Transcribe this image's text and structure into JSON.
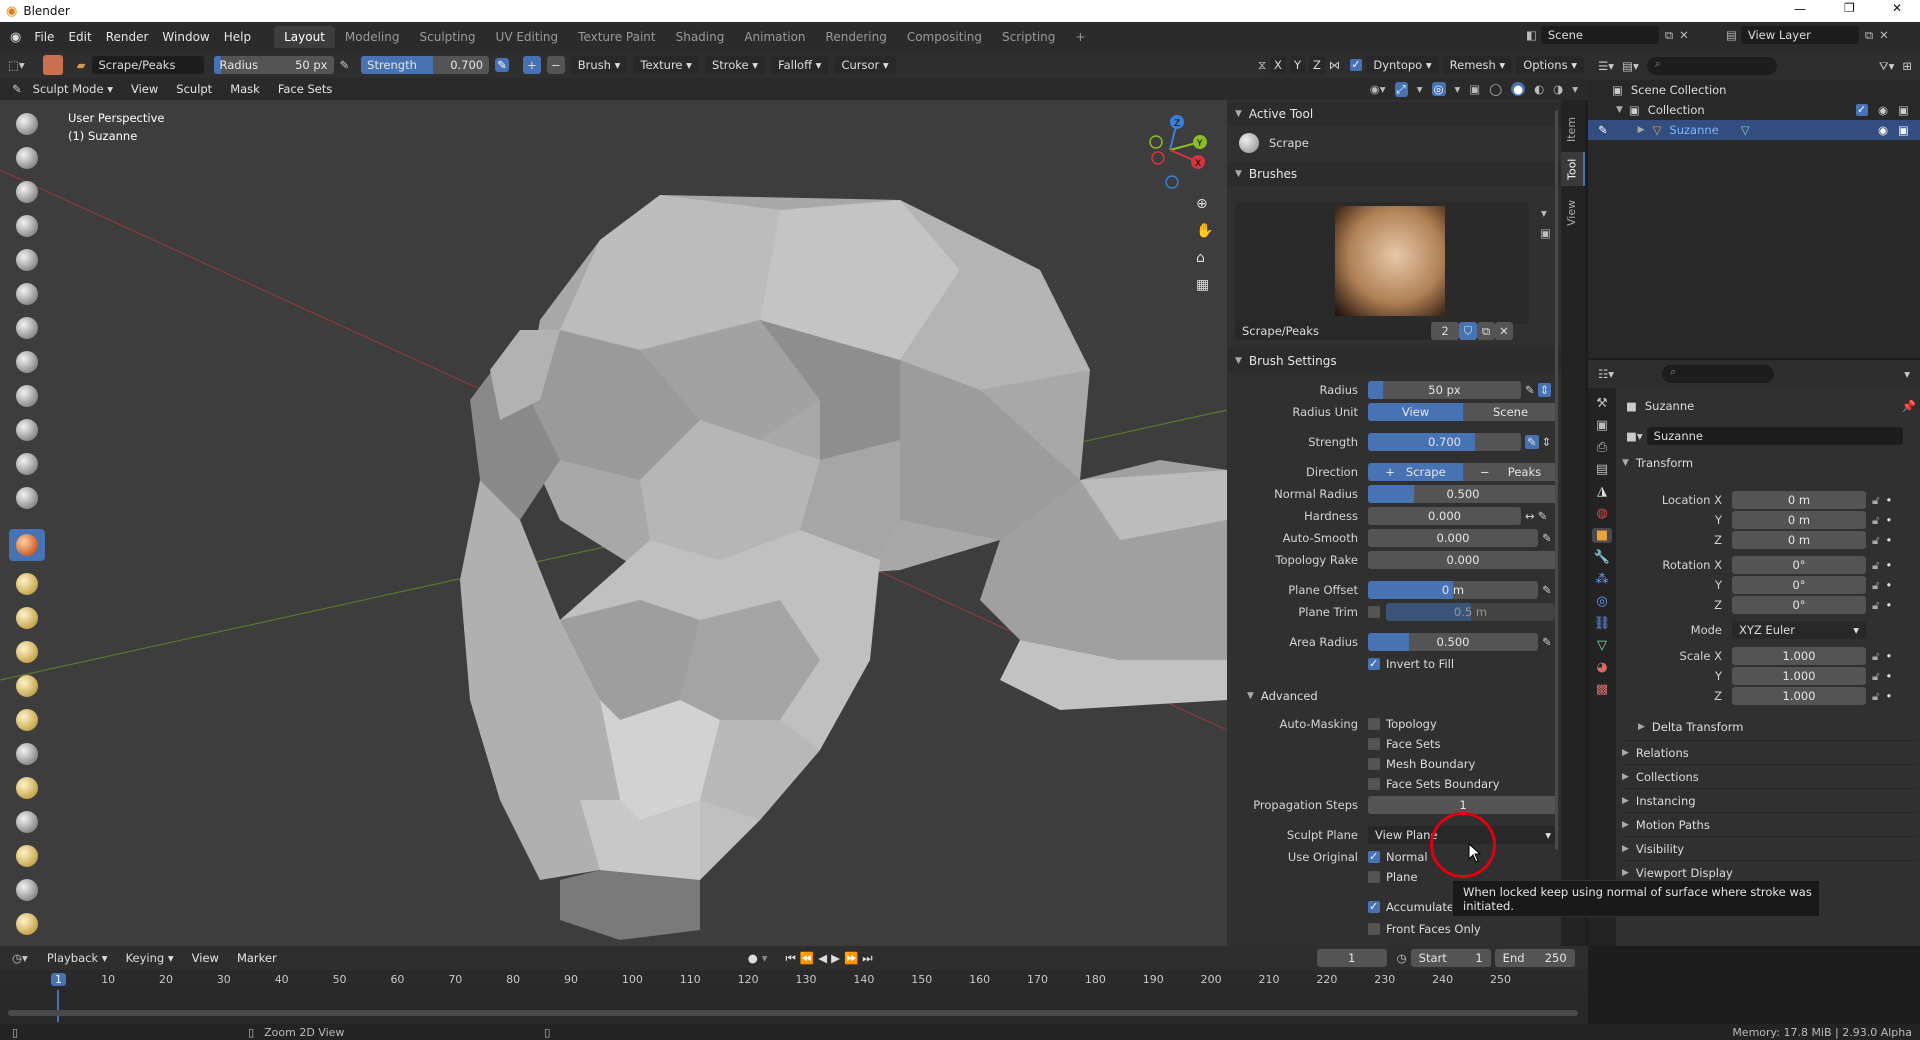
{
  "app": {
    "title": "Blender",
    "memory": "Memory: 17.8 MiB | 2.93.0 Alpha"
  },
  "menus": [
    "File",
    "Edit",
    "Render",
    "Window",
    "Help"
  ],
  "workspaces": [
    "Layout",
    "Modeling",
    "Sculpting",
    "UV Editing",
    "Texture Paint",
    "Shading",
    "Animation",
    "Rendering",
    "Compositing",
    "Scripting"
  ],
  "scene": {
    "name": "Scene",
    "view_layer": "View Layer"
  },
  "tool_header": {
    "brush_name": "Scrape/Peaks",
    "radius_label": "Radius",
    "radius_value": "50 px",
    "strength_label": "Strength",
    "strength_value": "0.700",
    "menus": [
      "Brush",
      "Texture",
      "Stroke",
      "Falloff",
      "Cursor"
    ],
    "axes": [
      "X",
      "Y",
      "Z"
    ],
    "dyntopo": "Dyntopo",
    "remesh": "Remesh",
    "options": "Options"
  },
  "viewport_header": {
    "mode": "Sculpt Mode",
    "menus": [
      "View",
      "Sculpt",
      "Mask",
      "Face Sets"
    ]
  },
  "viewport": {
    "perspective": "User Perspective",
    "object": "(1) Suzanne"
  },
  "sidebar_tabs": [
    "Item",
    "Tool",
    "View"
  ],
  "npanel": {
    "active_tool_header": "Active Tool",
    "active_tool": "Scrape",
    "brushes_header": "Brushes",
    "brush_name": "Scrape/Peaks",
    "brush_users": "2",
    "brush_settings_header": "Brush Settings",
    "radius": {
      "label": "Radius",
      "value": "50 px",
      "fill": 0.1
    },
    "radius_unit": {
      "label": "Radius Unit",
      "options": [
        "View",
        "Scene"
      ],
      "selected": "View"
    },
    "strength": {
      "label": "Strength",
      "value": "0.700",
      "fill": 0.7
    },
    "direction": {
      "label": "Direction",
      "options": [
        "Scrape",
        "Peaks"
      ],
      "selected": "Scrape"
    },
    "normal_radius": {
      "label": "Normal Radius",
      "value": "0.500",
      "fill": 0.25
    },
    "hardness": {
      "label": "Hardness",
      "value": "0.000"
    },
    "auto_smooth": {
      "label": "Auto-Smooth",
      "value": "0.000"
    },
    "topology_rake": {
      "label": "Topology Rake",
      "value": "0.000"
    },
    "plane_offset": {
      "label": "Plane Offset",
      "value": "0 m",
      "fill": 0.5
    },
    "plane_trim": {
      "label": "Plane Trim",
      "value": "0.5 m"
    },
    "area_radius": {
      "label": "Area Radius",
      "value": "0.500",
      "fill": 0.25
    },
    "invert_to_fill": "Invert to Fill",
    "advanced_header": "Advanced",
    "auto_masking_label": "Auto-Masking",
    "auto_masking": [
      "Topology",
      "Face Sets",
      "Mesh Boundary",
      "Face Sets Boundary"
    ],
    "propagation_steps": {
      "label": "Propagation Steps",
      "value": "1"
    },
    "sculpt_plane": {
      "label": "Sculpt Plane",
      "value": "View Plane"
    },
    "use_original_label": "Use Original",
    "use_original_normal": "Normal",
    "use_original_plane": "Plane",
    "accumulate": "Accumulate",
    "front_faces_only": "Front Faces Only"
  },
  "tooltip": "When locked keep using normal of surface where stroke was initiated.",
  "outliner": {
    "root": "Scene Collection",
    "collection": "Collection",
    "object": "Suzanne"
  },
  "properties": {
    "object_name": "Suzanne",
    "data_name": "Suzanne",
    "transform_header": "Transform",
    "location_label": "Location X",
    "loc": [
      "0 m",
      "0 m",
      "0 m"
    ],
    "rotation_label": "Rotation X",
    "rot": [
      "0°",
      "0°",
      "0°"
    ],
    "mode_label": "Mode",
    "mode": "XYZ Euler",
    "scale_label": "Scale X",
    "scale": [
      "1.000",
      "1.000",
      "1.000"
    ],
    "y": "Y",
    "z": "Z",
    "delta": "Delta Transform",
    "sections": [
      "Relations",
      "Collections",
      "Instancing",
      "Motion Paths",
      "Visibility",
      "Viewport Display"
    ]
  },
  "timeline": {
    "menus": [
      "Playback",
      "Keying",
      "View",
      "Marker"
    ],
    "current_frame": "1",
    "start_label": "Start",
    "start": "1",
    "end_label": "End",
    "end": "250",
    "ticks": [
      "1",
      "10",
      "20",
      "30",
      "40",
      "50",
      "60",
      "70",
      "80",
      "90",
      "100",
      "110",
      "120",
      "130",
      "140",
      "150",
      "160",
      "170",
      "180",
      "190",
      "200",
      "210",
      "220",
      "230",
      "240",
      "250"
    ]
  },
  "statusbar": {
    "hint": "Zoom 2D View"
  },
  "colors": {
    "accent": "#4772b3",
    "selection": "#334d80",
    "annotation": "#e0000f"
  }
}
